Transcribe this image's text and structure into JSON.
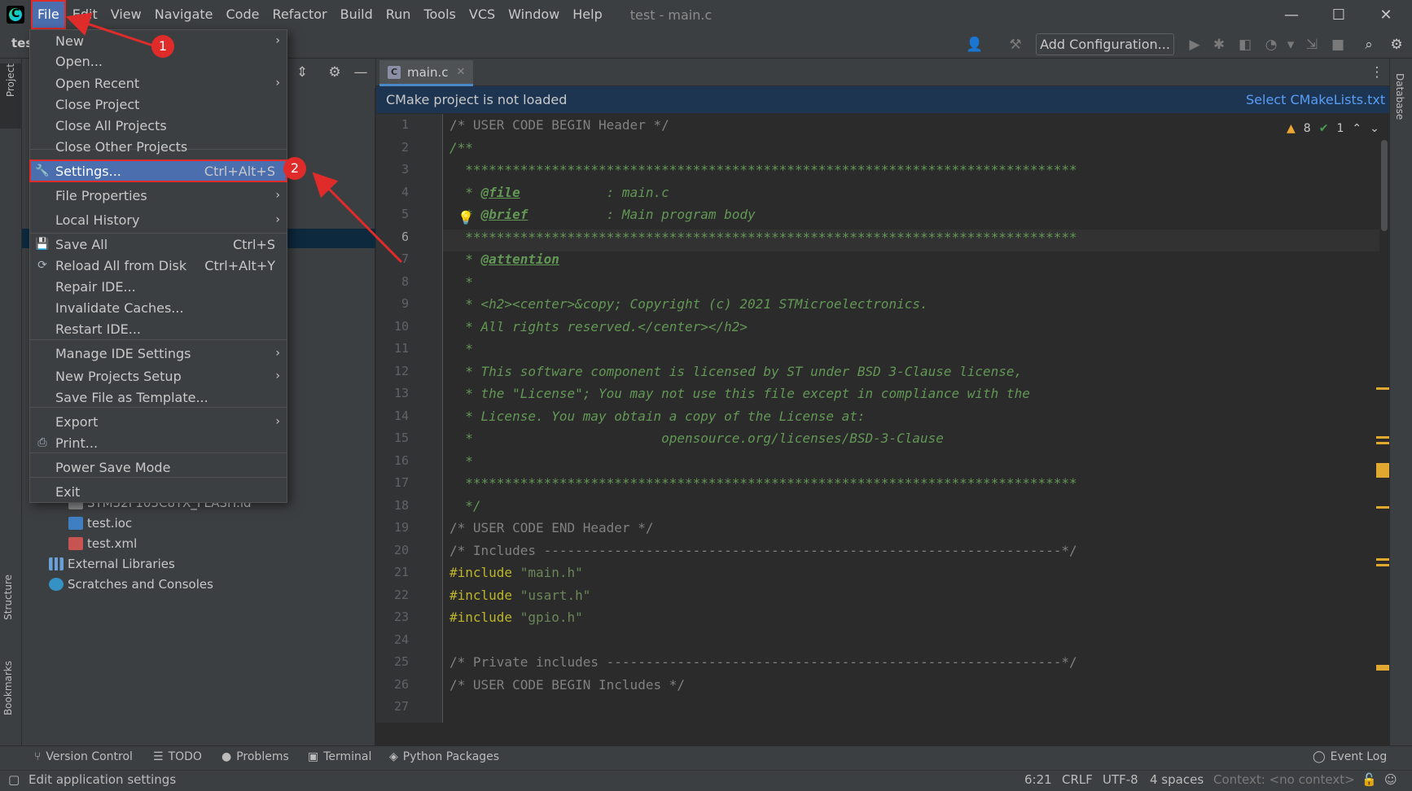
{
  "menubar": {
    "items": [
      "File",
      "Edit",
      "View",
      "Navigate",
      "Code",
      "Refactor",
      "Build",
      "Run",
      "Tools",
      "VCS",
      "Window",
      "Help"
    ],
    "window_title": "test - main.c"
  },
  "toolbar": {
    "project_crumb": "tes",
    "add_configuration": "Add Configuration..."
  },
  "left_strip": {
    "project_tab": "Project",
    "structure_tab": "Structure",
    "bookmarks_tab": "Bookmarks"
  },
  "right_strip": {
    "database_tab": "Database"
  },
  "file_menu": {
    "items": [
      {
        "label": "New",
        "shortcut": "",
        "submenu": true
      },
      {
        "label": "Open...",
        "shortcut": "",
        "submenu": false
      },
      {
        "label": "Open Recent",
        "shortcut": "",
        "submenu": true
      },
      {
        "label": "Close Project",
        "shortcut": "",
        "submenu": false
      },
      {
        "label": "Close All Projects",
        "shortcut": "",
        "submenu": false
      },
      {
        "label": "Close Other Projects",
        "shortcut": "",
        "submenu": false
      },
      {
        "label": "Settings...",
        "shortcut": "Ctrl+Alt+S",
        "submenu": false
      },
      {
        "label": "File Properties",
        "shortcut": "",
        "submenu": true
      },
      {
        "label": "Local History",
        "shortcut": "",
        "submenu": true
      },
      {
        "label": "Save All",
        "shortcut": "Ctrl+S",
        "submenu": false
      },
      {
        "label": "Reload All from Disk",
        "shortcut": "Ctrl+Alt+Y",
        "submenu": false
      },
      {
        "label": "Repair IDE...",
        "shortcut": "",
        "submenu": false
      },
      {
        "label": "Invalidate Caches...",
        "shortcut": "",
        "submenu": false
      },
      {
        "label": "Restart IDE...",
        "shortcut": "",
        "submenu": false
      },
      {
        "label": "Manage IDE Settings",
        "shortcut": "",
        "submenu": true
      },
      {
        "label": "New Projects Setup",
        "shortcut": "",
        "submenu": true
      },
      {
        "label": "Save File as Template...",
        "shortcut": "",
        "submenu": false
      },
      {
        "label": "Export",
        "shortcut": "",
        "submenu": true
      },
      {
        "label": "Print...",
        "shortcut": "",
        "submenu": false
      },
      {
        "label": "Power Save Mode",
        "shortcut": "",
        "submenu": false
      },
      {
        "label": "Exit",
        "shortcut": "",
        "submenu": false
      }
    ]
  },
  "project_tree": {
    "items": [
      {
        "label": "STM32F103C8TX_FLASH.ld",
        "icon": "ld-file-icon"
      },
      {
        "label": "test.ioc",
        "icon": "ioc-file-icon"
      },
      {
        "label": "test.xml",
        "icon": "xml-file-icon"
      },
      {
        "label": "External Libraries",
        "icon": "library-icon"
      },
      {
        "label": "Scratches and Consoles",
        "icon": "scratches-icon"
      }
    ]
  },
  "editor": {
    "tab": "main.c",
    "banner": "CMake project is not loaded",
    "banner_link": "Select CMakeLists.txt",
    "warnings": "8",
    "checks": "1",
    "lines": [
      "/* USER CODE BEGIN Header */",
      "/**",
      "  ******************************************************************************",
      "  * @file           : main.c",
      "  * @brief          : Main program body",
      "  ******************************************************************************",
      "  * @attention",
      "  *",
      "  * <h2><center>&copy; Copyright (c) 2021 STMicroelectronics.",
      "  * All rights reserved.</center></h2>",
      "  *",
      "  * This software component is licensed by ST under BSD 3-Clause license,",
      "  * the \"License\"; You may not use this file except in compliance with the",
      "  * License. You may obtain a copy of the License at:",
      "  *                        opensource.org/licenses/BSD-3-Clause",
      "  *",
      "  ******************************************************************************",
      "  */",
      "/* USER CODE END Header */",
      "/* Includes ------------------------------------------------------------------*/",
      "#include \"main.h\"",
      "#include \"usart.h\"",
      "#include \"gpio.h\"",
      "",
      "/* Private includes ----------------------------------------------------------*/",
      "/* USER CODE BEGIN Includes */",
      ""
    ]
  },
  "bottom_tabs": [
    "Version Control",
    "TODO",
    "Problems",
    "Terminal",
    "Python Packages",
    "Event Log"
  ],
  "status": {
    "message": "Edit application settings",
    "position": "6:21",
    "line_sep": "CRLF",
    "encoding": "UTF-8",
    "indent": "4 spaces",
    "context": "Context: <no context>"
  },
  "annotations": [
    "1",
    "2"
  ],
  "colors": {
    "accent": "#4b6eaf",
    "annotation": "#e02b2b",
    "doc_comment": "#629755"
  }
}
